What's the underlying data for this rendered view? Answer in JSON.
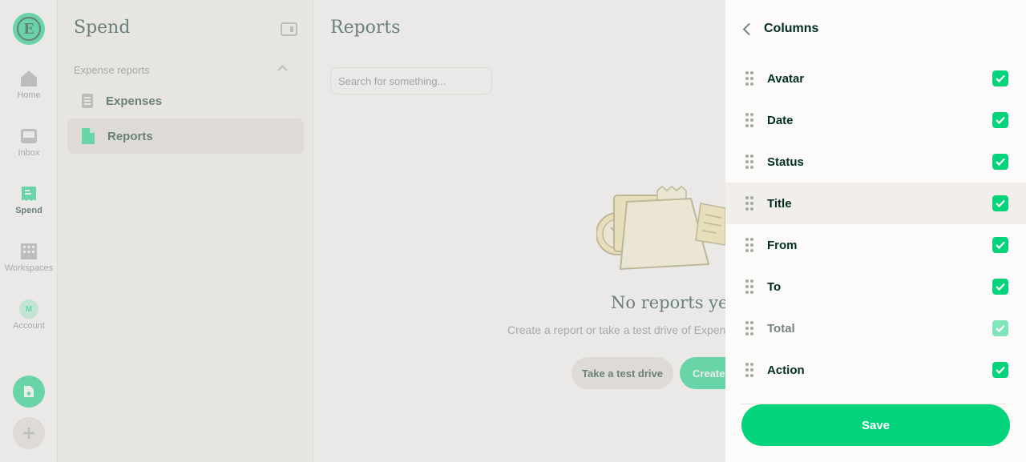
{
  "rail": {
    "logo_letter": "E",
    "items": [
      {
        "label": "Home",
        "icon": "home-icon"
      },
      {
        "label": "Inbox",
        "icon": "inbox-icon"
      },
      {
        "label": "Spend",
        "icon": "receipt-icon"
      },
      {
        "label": "Workspaces",
        "icon": "building-icon"
      },
      {
        "label": "Account",
        "icon": "avatar",
        "avatar_letter": "M"
      }
    ],
    "active": "Spend"
  },
  "sidebar": {
    "title": "Spend",
    "section": "Expense reports",
    "links": [
      {
        "label": "Expenses",
        "icon": "document-icon"
      },
      {
        "label": "Reports",
        "icon": "report-icon"
      }
    ],
    "active": "Reports"
  },
  "main": {
    "title": "Reports",
    "search_placeholder": "Search for something...",
    "empty_title": "No reports yet",
    "empty_subtitle": "Create a report or take a test drive of Expensify",
    "test_drive_label": "Take a test drive",
    "create_label": "Create report"
  },
  "panel": {
    "title": "Columns",
    "columns": [
      {
        "label": "Avatar",
        "checked": true,
        "disabled": false
      },
      {
        "label": "Date",
        "checked": true,
        "disabled": false
      },
      {
        "label": "Status",
        "checked": true,
        "disabled": false
      },
      {
        "label": "Title",
        "checked": true,
        "disabled": false,
        "highlighted": true
      },
      {
        "label": "From",
        "checked": true,
        "disabled": false
      },
      {
        "label": "To",
        "checked": true,
        "disabled": false
      },
      {
        "label": "Total",
        "checked": true,
        "disabled": true
      },
      {
        "label": "Action",
        "checked": true,
        "disabled": false
      }
    ],
    "save_label": "Save"
  },
  "colors": {
    "accent": "#03d47c",
    "text": "#002e22",
    "muted": "#76847e",
    "border": "#e6e1da"
  }
}
